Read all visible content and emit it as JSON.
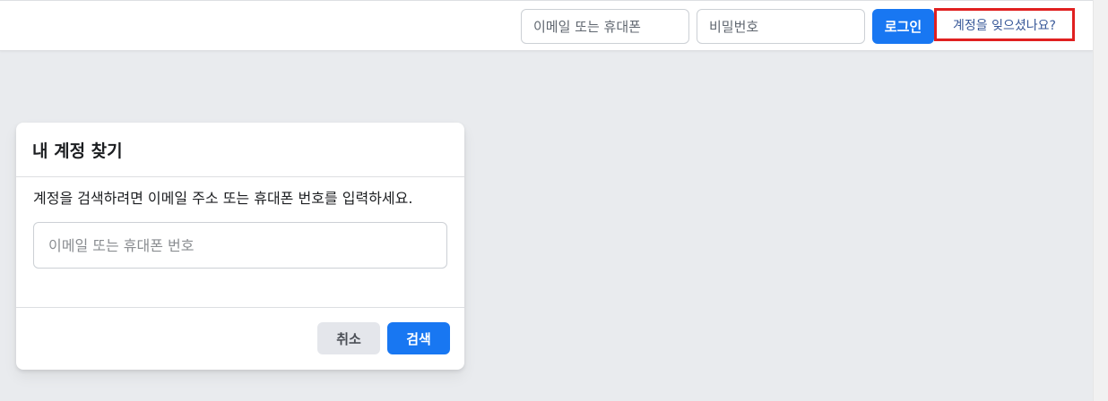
{
  "header": {
    "email_placeholder": "이메일 또는 휴대폰",
    "password_placeholder": "비밀번호",
    "login_label": "로그인",
    "forgot_label": "계정을 잊으셨나요?"
  },
  "card": {
    "title": "내 계정 찾기",
    "instruction": "계정을 검색하려면 이메일 주소 또는 휴대폰 번호를 입력하세요.",
    "input_placeholder": "이메일 또는 휴대폰 번호",
    "cancel_label": "취소",
    "search_label": "검색"
  },
  "colors": {
    "primary": "#1877f2",
    "background": "#e9ebee",
    "link": "#385898",
    "highlight": "#e02020"
  }
}
